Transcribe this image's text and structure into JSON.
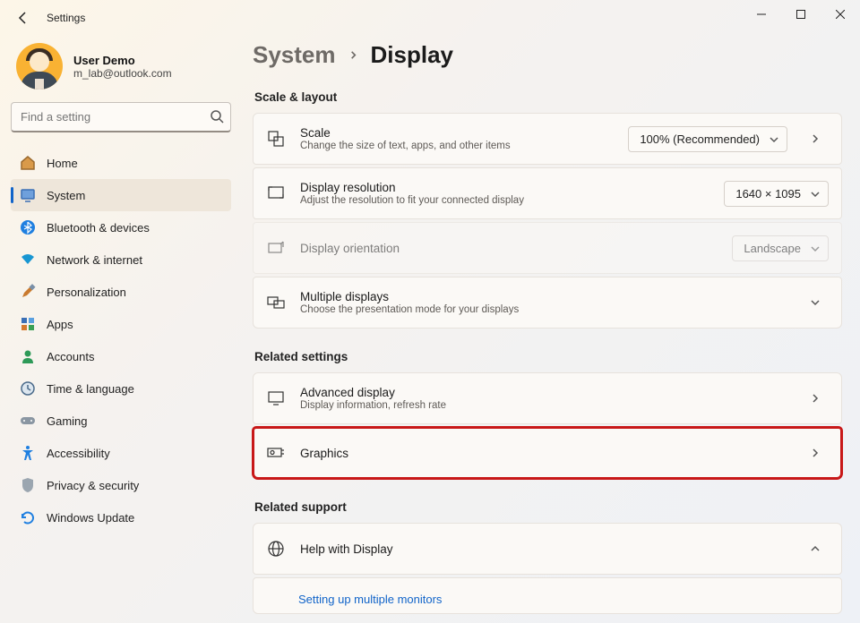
{
  "window": {
    "title": "Settings"
  },
  "user": {
    "name": "User Demo",
    "email": "m_lab@outlook.com"
  },
  "search": {
    "placeholder": "Find a setting"
  },
  "nav": {
    "items": [
      {
        "label": "Home"
      },
      {
        "label": "System"
      },
      {
        "label": "Bluetooth & devices"
      },
      {
        "label": "Network & internet"
      },
      {
        "label": "Personalization"
      },
      {
        "label": "Apps"
      },
      {
        "label": "Accounts"
      },
      {
        "label": "Time & language"
      },
      {
        "label": "Gaming"
      },
      {
        "label": "Accessibility"
      },
      {
        "label": "Privacy & security"
      },
      {
        "label": "Windows Update"
      }
    ]
  },
  "breadcrumb": {
    "parent": "System",
    "current": "Display"
  },
  "sections": {
    "scale_layout": {
      "title": "Scale & layout",
      "scale": {
        "title": "Scale",
        "subtitle": "Change the size of text, apps, and other items",
        "value": "100% (Recommended)"
      },
      "resolution": {
        "title": "Display resolution",
        "subtitle": "Adjust the resolution to fit your connected display",
        "value": "1640 × 1095"
      },
      "orientation": {
        "title": "Display orientation",
        "value": "Landscape"
      },
      "multiple": {
        "title": "Multiple displays",
        "subtitle": "Choose the presentation mode for your displays"
      }
    },
    "related_settings": {
      "title": "Related settings",
      "advanced": {
        "title": "Advanced display",
        "subtitle": "Display information, refresh rate"
      },
      "graphics": {
        "title": "Graphics"
      }
    },
    "related_support": {
      "title": "Related support",
      "help": {
        "title": "Help with Display"
      },
      "link": "Setting up multiple monitors"
    }
  }
}
